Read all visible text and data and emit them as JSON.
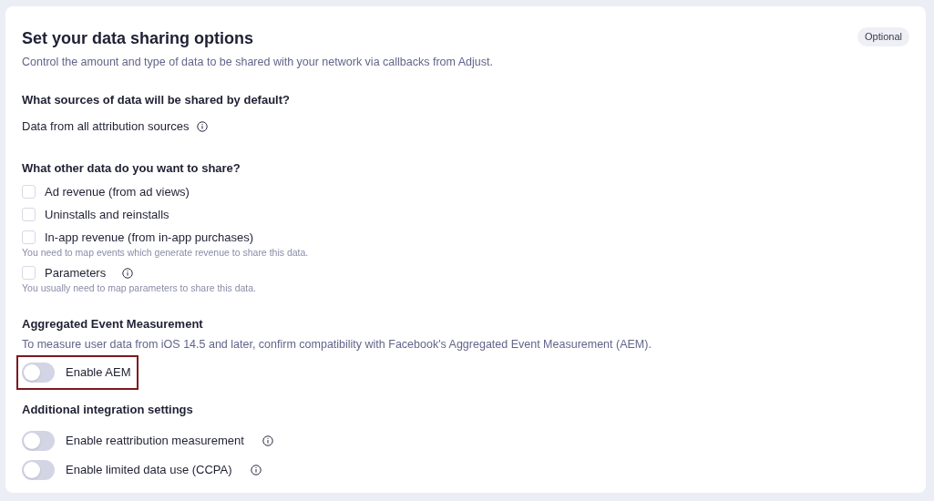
{
  "card": {
    "title": "Set your data sharing options",
    "badge": "Optional",
    "description": "Control the amount and type of data to be shared with your network via callbacks from Adjust."
  },
  "default_sources": {
    "heading": "What sources of data will be shared by default?",
    "text": "Data from all attribution sources",
    "info": true
  },
  "other_data": {
    "heading": "What other data do you want to share?",
    "options": [
      {
        "label": "Ad revenue (from ad views)",
        "checked": false,
        "info": false
      },
      {
        "label": "Uninstalls and reinstalls",
        "checked": false,
        "info": false
      },
      {
        "label": "In-app revenue (from in-app purchases)",
        "checked": false,
        "info": false,
        "note": "You need to map events which generate revenue to share this data."
      },
      {
        "label": "Parameters",
        "checked": false,
        "info": true,
        "note": "You usually need to map parameters to share this data."
      }
    ]
  },
  "aem": {
    "heading": "Aggregated Event Measurement",
    "description": "To measure user data from iOS 14.5 and later, confirm compatibility with Facebook's Aggregated Event Measurement (AEM).",
    "toggle": {
      "label": "Enable AEM",
      "on": false,
      "highlighted": true,
      "info": false
    }
  },
  "additional": {
    "heading": "Additional integration settings",
    "toggles": [
      {
        "label": "Enable reattribution measurement",
        "on": false,
        "highlighted": false,
        "info": true
      },
      {
        "label": "Enable limited data use (CCPA)",
        "on": false,
        "highlighted": false,
        "info": true
      }
    ]
  }
}
